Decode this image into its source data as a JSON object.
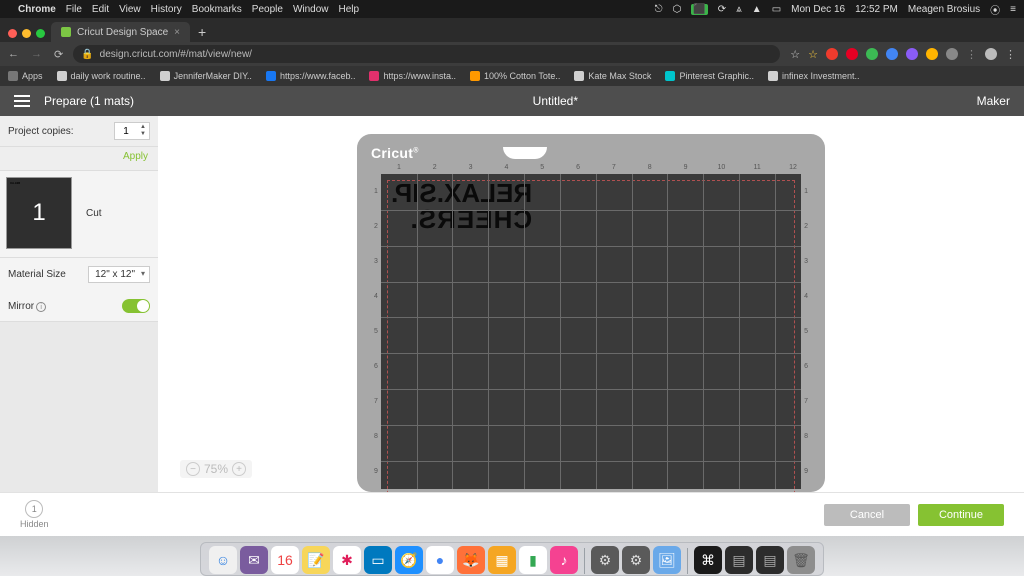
{
  "mac_menu": {
    "app": "Chrome",
    "items": [
      "File",
      "Edit",
      "View",
      "History",
      "Bookmarks",
      "People",
      "Window",
      "Help"
    ],
    "right": {
      "date": "Mon Dec 16",
      "time": "12:52 PM",
      "user": "Meagen Brosius"
    }
  },
  "browser": {
    "tab_title": "Cricut Design Space",
    "url": "design.cricut.com/#/mat/view/new/",
    "bookmarks": [
      {
        "label": "Apps",
        "color": "#777"
      },
      {
        "label": "daily work routine..",
        "color": "#d0d0d0"
      },
      {
        "label": "JenniferMaker DIY..",
        "color": "#d0d0d0"
      },
      {
        "label": "https://www.faceb..",
        "color": "#1877f2"
      },
      {
        "label": "https://www.insta..",
        "color": "#e1306c"
      },
      {
        "label": "100% Cotton Tote..",
        "color": "#ff9900"
      },
      {
        "label": "Kate Max Stock",
        "color": "#d0d0d0"
      },
      {
        "label": "Pinterest Graphic..",
        "color": "#00c4cc"
      },
      {
        "label": "infinex Investment..",
        "color": "#d0d0d0"
      }
    ],
    "ext_colors": [
      "#ef3b2d",
      "#e60023",
      "#3cba54",
      "#4285f4",
      "#8a5cf6",
      "#ffb400",
      "#888"
    ]
  },
  "cricut": {
    "prepare_label": "Prepare (1 mats)",
    "title": "Untitled*",
    "machine": "Maker",
    "project_copies_label": "Project copies:",
    "project_copies_value": "1",
    "apply_label": "Apply",
    "mat_number": "1",
    "cut_label": "Cut",
    "material_size_label": "Material Size",
    "material_size_value": "12\" x 12\"",
    "mirror_label": "Mirror",
    "mirror_on": true,
    "zoom_label": "75%",
    "hidden_count": "1",
    "hidden_label": "Hidden",
    "cancel_label": "Cancel",
    "continue_label": "Continue",
    "brand": "Cricut",
    "ruler_ticks": [
      "1",
      "2",
      "3",
      "4",
      "5",
      "6",
      "7",
      "8",
      "9",
      "10",
      "11",
      "12"
    ],
    "design_line1": "RELAX.SIP.",
    "design_line2": "CHEERS."
  },
  "dock": [
    {
      "bg": "#f0f0f0",
      "glyph": "☺",
      "fg": "#2a7de1"
    },
    {
      "bg": "#7a5c9e",
      "glyph": "✉",
      "fg": "#fff"
    },
    {
      "bg": "#fff",
      "glyph": "16",
      "fg": "#e44"
    },
    {
      "bg": "#f7d65a",
      "glyph": "📝",
      "fg": "#555"
    },
    {
      "bg": "#fff",
      "glyph": "✱",
      "fg": "#e01e5a"
    },
    {
      "bg": "#0079bf",
      "glyph": "▭",
      "fg": "#fff"
    },
    {
      "bg": "#1e90ff",
      "glyph": "🧭",
      "fg": "#fff"
    },
    {
      "bg": "#fff",
      "glyph": "●",
      "fg": "#4285f4"
    },
    {
      "bg": "#ff7139",
      "glyph": "🦊",
      "fg": "#fff"
    },
    {
      "bg": "#f5a623",
      "glyph": "▦",
      "fg": "#fff"
    },
    {
      "bg": "#fff",
      "glyph": "▮",
      "fg": "#34a853"
    },
    {
      "bg": "#f54291",
      "glyph": "♪",
      "fg": "#fff"
    },
    {
      "bg": "#5a5a5a",
      "glyph": "⚙",
      "fg": "#ddd"
    },
    {
      "bg": "#5a5a5a",
      "glyph": "⚙",
      "fg": "#ddd"
    },
    {
      "bg": "#6aa9e9",
      "glyph": "🖼",
      "fg": "#fff"
    },
    {
      "bg": "#1a1a1a",
      "glyph": "⌘",
      "fg": "#fff"
    },
    {
      "bg": "#2c2c2c",
      "glyph": "▤",
      "fg": "#aaa"
    },
    {
      "bg": "#2c2c2c",
      "glyph": "▤",
      "fg": "#aaa"
    },
    {
      "bg": "#8e8e8e",
      "glyph": "🗑",
      "fg": "#555"
    }
  ]
}
